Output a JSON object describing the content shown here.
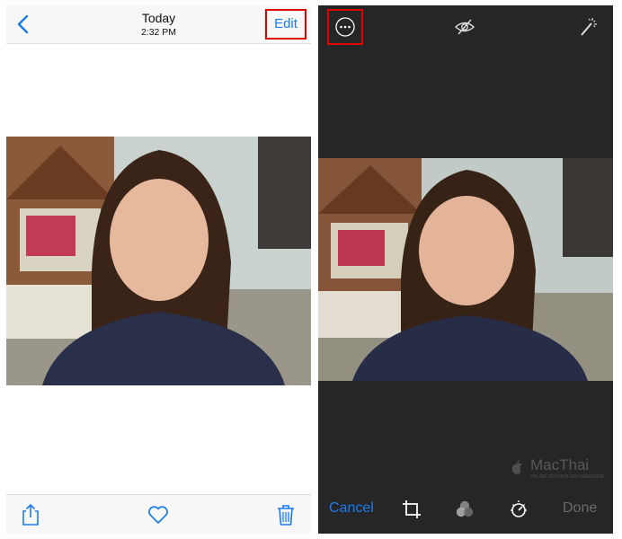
{
  "left": {
    "header": {
      "title": "Today",
      "subtitle": "2:32 PM",
      "edit_label": "Edit",
      "back_icon": "chevron-left-icon"
    },
    "toolbar": {
      "icons": [
        "share-icon",
        "heart-icon",
        "trash-icon"
      ]
    }
  },
  "right": {
    "top_icons": [
      "more-options-icon",
      "hide-eye-icon",
      "magic-wand-icon"
    ],
    "toolbar": {
      "cancel_label": "Cancel",
      "done_label": "Done",
      "icons": [
        "crop-icon",
        "filters-icon",
        "adjust-icon"
      ]
    },
    "watermark": {
      "brand": "MacThai",
      "tagline": "ONLINE TECHNOLOGY MAGAZINE"
    }
  },
  "colors": {
    "accent": "#1a7cf5",
    "highlight_box": "#e00000",
    "editor_bg": "#262626",
    "done_disabled": "#6b6b6b"
  }
}
